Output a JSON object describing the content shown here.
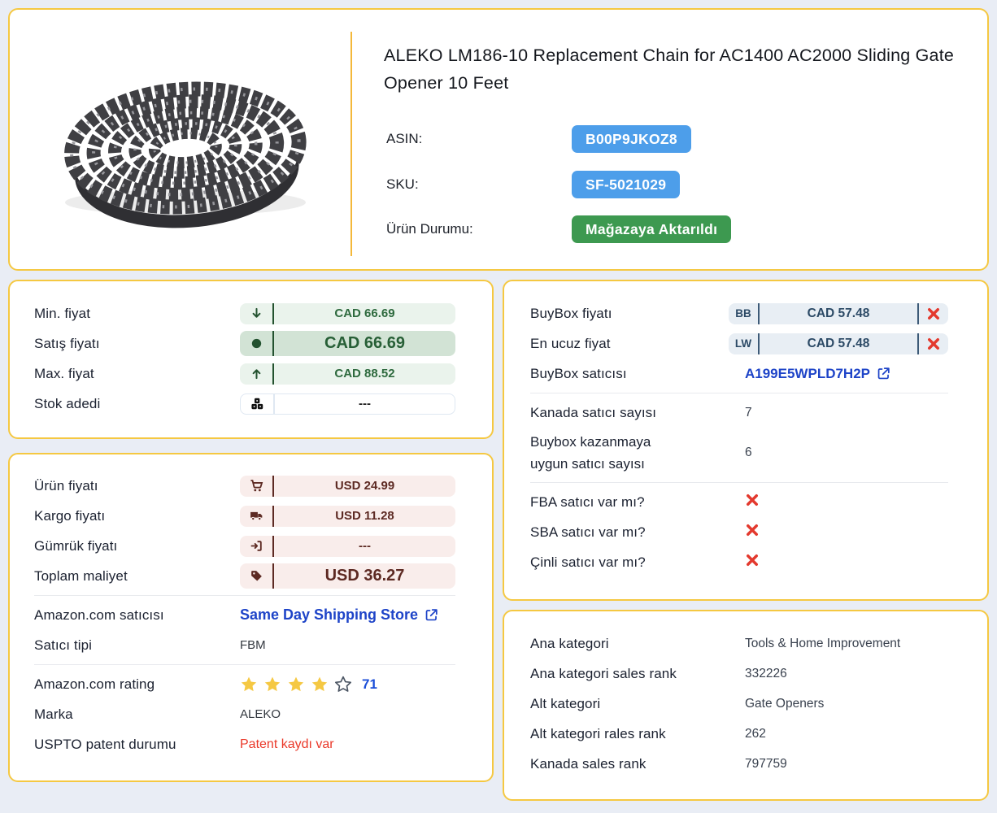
{
  "product": {
    "title": "ALEKO LM186-10 Replacement Chain for AC1400 AC2000 Sliding Gate Opener 10 Feet",
    "asin_label": "ASIN:",
    "asin": "B00P9JKOZ8",
    "sku_label": "SKU:",
    "sku": "SF-5021029",
    "status_label": "Ürün Durumu:",
    "status": "Mağazaya Aktarıldı",
    "image_alt": "coiled roller chain"
  },
  "price_card": {
    "rows": [
      {
        "label": "Min. fiyat",
        "value": "CAD 66.69",
        "icon": "arrow-down"
      },
      {
        "label": "Satış fiyatı",
        "value": "CAD 66.69",
        "icon": "circle"
      },
      {
        "label": "Max. fiyat",
        "value": "CAD 88.52",
        "icon": "arrow-up"
      },
      {
        "label": "Stok adedi",
        "value": "---",
        "icon": "boxes"
      }
    ]
  },
  "cost_card": {
    "rows": [
      {
        "label": "Ürün fiyatı",
        "value": "USD 24.99",
        "icon": "cart"
      },
      {
        "label": "Kargo fiyatı",
        "value": "USD 11.28",
        "icon": "truck"
      },
      {
        "label": "Gümrük fiyatı",
        "value": "---",
        "icon": "import"
      },
      {
        "label": "Toplam maliyet",
        "value": "USD 36.27",
        "icon": "tag"
      }
    ],
    "seller_label": "Amazon.com satıcısı",
    "seller_link": "Same Day Shipping Store",
    "seller_type_label": "Satıcı tipi",
    "seller_type": "FBM",
    "rating_label": "Amazon.com rating",
    "rating_stars": 4,
    "rating_total_stars": 5,
    "rating_count": "71",
    "brand_label": "Marka",
    "brand": "ALEKO",
    "patent_label": "USPTO patent durumu",
    "patent_status": "Patent kaydı var"
  },
  "buybox_card": {
    "rows": [
      {
        "label": "BuyBox fiyatı",
        "prefix": "BB",
        "value": "CAD 57.48",
        "status_icon": "x"
      },
      {
        "label": "En ucuz fiyat",
        "prefix": "LW",
        "value": "CAD 57.48",
        "status_icon": "x"
      }
    ],
    "buybox_seller_label": "BuyBox satıcısı",
    "buybox_seller": "A199E5WPLD7H2P",
    "canada_sellers_label": "Kanada satıcı sayısı",
    "canada_sellers": "7",
    "eligible_label_line1": "Buybox kazanmaya",
    "eligible_label_line2": "uygun satıcı sayısı",
    "eligible_sellers": "6",
    "fba_label": "FBA satıcı var mı?",
    "fba_value_icon": "x",
    "sba_label": "SBA satıcı var mı?",
    "sba_value_icon": "x",
    "chinese_label": "Çinli satıcı var mı?",
    "chinese_value_icon": "x"
  },
  "category_card": {
    "rows": [
      {
        "label": "Ana kategori",
        "value": "Tools & Home Improvement"
      },
      {
        "label": "Ana kategori sales rank",
        "value": "332226"
      },
      {
        "label": "Alt kategori",
        "value": "Gate Openers"
      },
      {
        "label": "Alt kategori rales rank",
        "value": "262"
      },
      {
        "label": "Kanada sales rank",
        "value": "797759"
      }
    ]
  },
  "colors": {
    "card_border": "#f5c842",
    "badge_blue": "#4d9eea",
    "badge_green": "#3d9950",
    "pill_green_bg": "#eaf3ec",
    "pill_green_text": "#2e6a3e",
    "pill_pink_bg": "#f9edeb",
    "pill_pink_text": "#5d2a23",
    "pill_blue_bg": "#e8eef4",
    "pill_blue_text": "#2c4a66",
    "link_blue": "#1e44c8",
    "error_red": "#e3392e",
    "star_yellow": "#f5c843",
    "page_bg": "#e9edf5"
  }
}
